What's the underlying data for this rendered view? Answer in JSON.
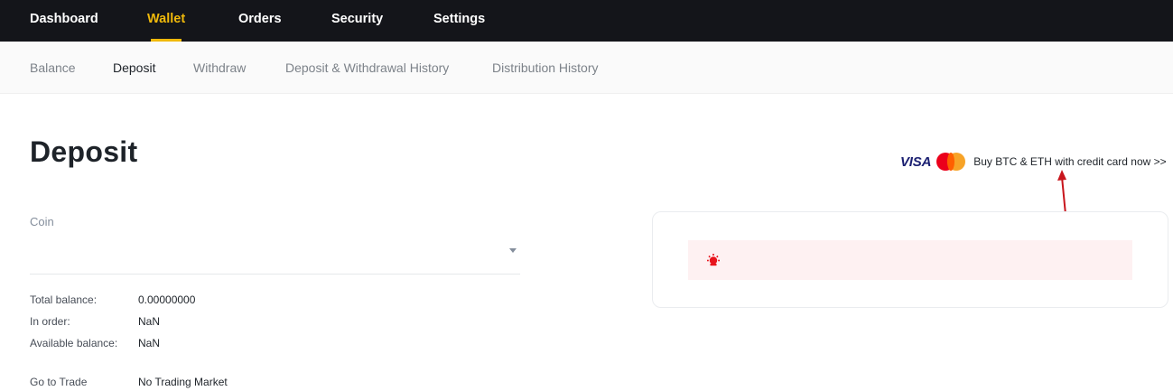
{
  "topnav": {
    "items": [
      {
        "label": "Dashboard",
        "active": false
      },
      {
        "label": "Wallet",
        "active": true
      },
      {
        "label": "Orders",
        "active": false
      },
      {
        "label": "Security",
        "active": false
      },
      {
        "label": "Settings",
        "active": false
      }
    ],
    "accent_color": "#f0b90b",
    "background_color": "#14151a"
  },
  "subnav": {
    "items": [
      {
        "label": "Balance",
        "active": false
      },
      {
        "label": "Deposit",
        "active": true
      },
      {
        "label": "Withdraw",
        "active": false
      },
      {
        "label": "Deposit & Withdrawal History",
        "active": false
      },
      {
        "label": "Distribution History",
        "active": false
      }
    ]
  },
  "page": {
    "title": "Deposit"
  },
  "coin_select": {
    "label": "Coin",
    "value": "",
    "icon": "chevron-down-icon"
  },
  "balances": {
    "total_label": "Total balance:",
    "total_value": "0.00000000",
    "in_order_label": "In order:",
    "in_order_value": "NaN",
    "available_label": "Available balance:",
    "available_value": "NaN"
  },
  "trade": {
    "label": "Go to Trade",
    "value": "No Trading Market"
  },
  "promo": {
    "visa_text": "VISA",
    "mastercard_text": "MasterCard",
    "text": "Buy BTC & ETH with credit card now >>"
  },
  "notice": {
    "icon": "alert-icon",
    "icon_color": "#e8141c",
    "background_color": "#fef1f2",
    "text": ""
  },
  "annotation": {
    "arrow_color": "#c8161d"
  }
}
